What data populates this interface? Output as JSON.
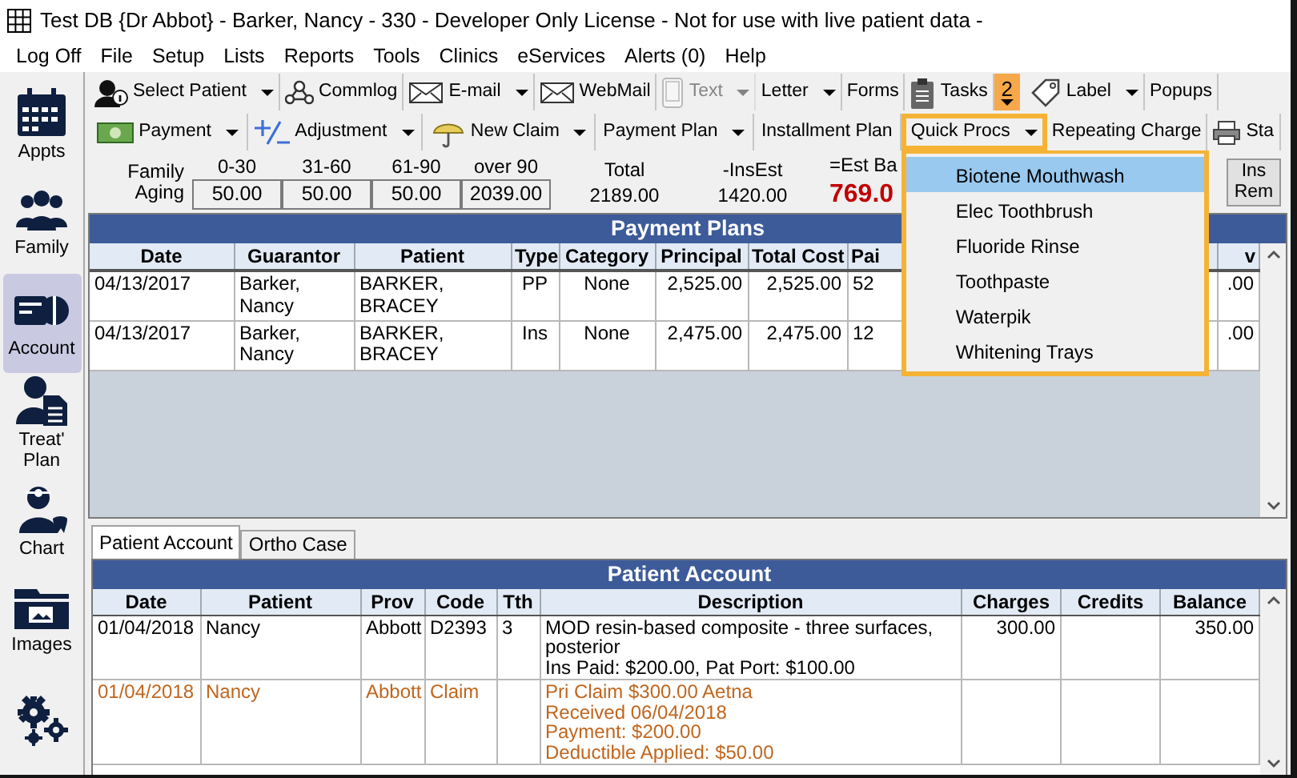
{
  "window": {
    "title": "Test DB {Dr Abbot} - Barker, Nancy - 330 - Developer Only License - Not for use with live patient data -"
  },
  "menu": [
    "Log Off",
    "File",
    "Setup",
    "Lists",
    "Reports",
    "Tools",
    "Clinics",
    "eServices",
    "Alerts (0)",
    "Help"
  ],
  "sidebar": [
    {
      "label": "Appts",
      "selected": false
    },
    {
      "label": "Family",
      "selected": false
    },
    {
      "label": "Account",
      "selected": true
    },
    {
      "label": "Treat' Plan",
      "selected": false
    },
    {
      "label": "Chart",
      "selected": false
    },
    {
      "label": "Images",
      "selected": false
    },
    {
      "selected": false
    }
  ],
  "toolbar_1": [
    {
      "kind": "button",
      "label": "Select Patient",
      "dropdown": true,
      "disabled": false
    },
    {
      "kind": "button",
      "label": "Commlog",
      "dropdown": false,
      "disabled": false
    },
    {
      "kind": "button",
      "label": "E-mail",
      "dropdown": true,
      "disabled": false
    },
    {
      "kind": "button",
      "label": "WebMail",
      "dropdown": false,
      "disabled": false
    },
    {
      "kind": "button",
      "label": "Text",
      "dropdown": true,
      "disabled": true
    },
    {
      "kind": "button",
      "label": "Letter",
      "dropdown": true,
      "disabled": false
    },
    {
      "kind": "button",
      "label": "Forms",
      "dropdown": false,
      "disabled": false
    },
    {
      "kind": "button",
      "label": "Tasks",
      "dropdown": false,
      "disabled": false
    },
    {
      "kind": "count",
      "label": "2",
      "dropdown": true,
      "disabled": false
    },
    {
      "kind": "button",
      "label": "Label",
      "dropdown": true,
      "disabled": false
    },
    {
      "kind": "button",
      "label": "Popups",
      "dropdown": false,
      "disabled": false
    }
  ],
  "toolbar_2": [
    {
      "label": "Payment",
      "dropdown": true,
      "highlighted": false
    },
    {
      "label": "Adjustment",
      "dropdown": true,
      "highlighted": false
    },
    {
      "label": "New Claim",
      "dropdown": true,
      "highlighted": false
    },
    {
      "label": "Payment Plan",
      "dropdown": true,
      "highlighted": false
    },
    {
      "label": "Installment Plan",
      "dropdown": false,
      "highlighted": false
    },
    {
      "label": "Quick Procs",
      "dropdown": true,
      "highlighted": true
    },
    {
      "label": "Repeating Charge",
      "dropdown": false,
      "highlighted": false
    },
    {
      "label": "Sta",
      "dropdown": false,
      "highlighted": false
    }
  ],
  "aging": {
    "label": "Family Aging",
    "buckets": [
      {
        "label": "0-30",
        "value": "50.00"
      },
      {
        "label": "31-60",
        "value": "50.00"
      },
      {
        "label": "61-90",
        "value": "50.00"
      },
      {
        "label": "over 90",
        "value": "2039.00"
      }
    ],
    "totals": [
      {
        "label": "Total",
        "value": "2189.00",
        "emphasis": false
      },
      {
        "label": "-InsEst",
        "value": "1420.00",
        "emphasis": false
      },
      {
        "label": "=Est Ba",
        "value": "769.0",
        "emphasis": true
      }
    ],
    "button": "Ins Rem"
  },
  "quick_procs_menu": {
    "highlighted": true,
    "items": [
      {
        "label": "Biotene Mouthwash",
        "selected": true
      },
      {
        "label": "Elec Toothbrush",
        "selected": false
      },
      {
        "label": "Fluoride Rinse",
        "selected": false
      },
      {
        "label": "Toothpaste",
        "selected": false
      },
      {
        "label": "Waterpik",
        "selected": false
      },
      {
        "label": "Whitening Trays",
        "selected": false
      }
    ]
  },
  "payment_plans": {
    "title": "Payment Plans",
    "columns": [
      "Date",
      "Guarantor",
      "Patient",
      "Type",
      "Category",
      "Principal",
      "Total Cost",
      "Pai",
      "v"
    ],
    "rows": [
      [
        "04/13/2017",
        "Barker, Nancy",
        "BARKER, BRACEY",
        "PP",
        "None",
        "2,525.00",
        "2,525.00",
        "52",
        ".00"
      ],
      [
        "04/13/2017",
        "Barker, Nancy",
        "BARKER, BRACEY",
        "Ins",
        "None",
        "2,475.00",
        "2,475.00",
        "12",
        ".00"
      ]
    ]
  },
  "account_tabs": [
    {
      "label": "Patient Account",
      "selected": true
    },
    {
      "label": "Ortho Case",
      "selected": false
    }
  ],
  "patient_account": {
    "title": "Patient Account",
    "columns": [
      "Date",
      "Patient",
      "Prov",
      "Code",
      "Tth",
      "Description",
      "Charges",
      "Credits",
      "Balance"
    ],
    "rows": [
      {
        "kind": "procedure",
        "date": "01/04/2018",
        "patient": "Nancy",
        "prov": "Abbott",
        "code": "D2393",
        "tth": "3",
        "description": [
          "MOD resin-based composite - three surfaces, posterior",
          "Ins Paid: $200.00, Pat Port: $100.00"
        ],
        "charges": "300.00",
        "balance": "350.00"
      },
      {
        "kind": "claim",
        "date": "01/04/2018",
        "patient": "Nancy",
        "prov": "Abbott",
        "code": "Claim",
        "description": [
          "Pri Claim $300.00 Aetna",
          "Received 06/04/2018",
          "Payment: $200.00",
          "Deductible Applied: $50.00"
        ]
      }
    ]
  }
}
